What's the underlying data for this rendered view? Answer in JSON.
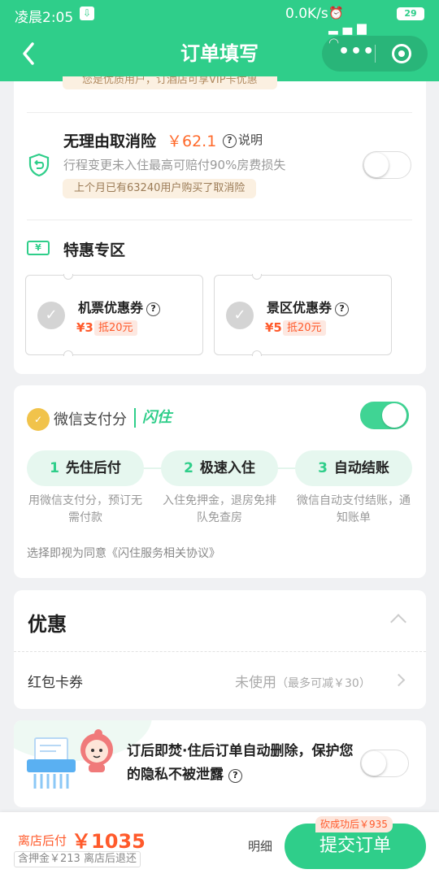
{
  "status_bar": {
    "time": "凌晨2:05",
    "speed": "0.0K/s",
    "icons": "⏰ ▂▄▆ ◠",
    "battery": "29",
    "download_icon": "⇩"
  },
  "nav": {
    "title": "订单填写",
    "more": "•••"
  },
  "card1": {
    "vip_note": "您是优质用户，订酒店可享VIP卡优惠",
    "insurance": {
      "title": "无理由取消险",
      "price": "￥62.1",
      "help": "说明",
      "desc": "行程变更未入住最高可赔付90%房费损失",
      "chip": "上个月已有63240用户购买了取消险",
      "toggle_on": false
    },
    "deals": {
      "title": "特惠专区",
      "icon_text": "¥",
      "coupons": [
        {
          "title": "机票优惠券",
          "amount": "¥3",
          "tag": "抵20元"
        },
        {
          "title": "景区优惠券",
          "amount": "¥5",
          "tag": "抵20元"
        }
      ]
    }
  },
  "card2": {
    "title": "微信支付分",
    "brand": "闪住",
    "toggle_on": true,
    "steps": [
      {
        "num": "1",
        "label": "先住后付",
        "desc": "用微信支付分，预订无需付款"
      },
      {
        "num": "2",
        "label": "极速入住",
        "desc": "入住免押金，退房免排队免查房"
      },
      {
        "num": "3",
        "label": "自动结账",
        "desc": "微信自动支付结账，通知账单"
      }
    ],
    "agreement": "选择即视为同意《闪住服务相关协议》"
  },
  "card3": {
    "title": "优惠",
    "hongbao_label": "红包卡券",
    "hongbao_value": "未使用",
    "hongbao_note": "（最多可减￥30）"
  },
  "card4": {
    "text": "订后即焚·住后订单自动删除，保护您的隐私不被泄露",
    "toggle_on": false
  },
  "bottom": {
    "pay_label": "离店后付",
    "amount": "￥1035",
    "deposit": "含押金￥213 离店后退还",
    "detail": "明细",
    "submit": "提交订单",
    "bargain": "砍成功后￥935"
  },
  "colors": {
    "brand_green": "#2fce8a",
    "price_orange": "#ff6a2b"
  }
}
